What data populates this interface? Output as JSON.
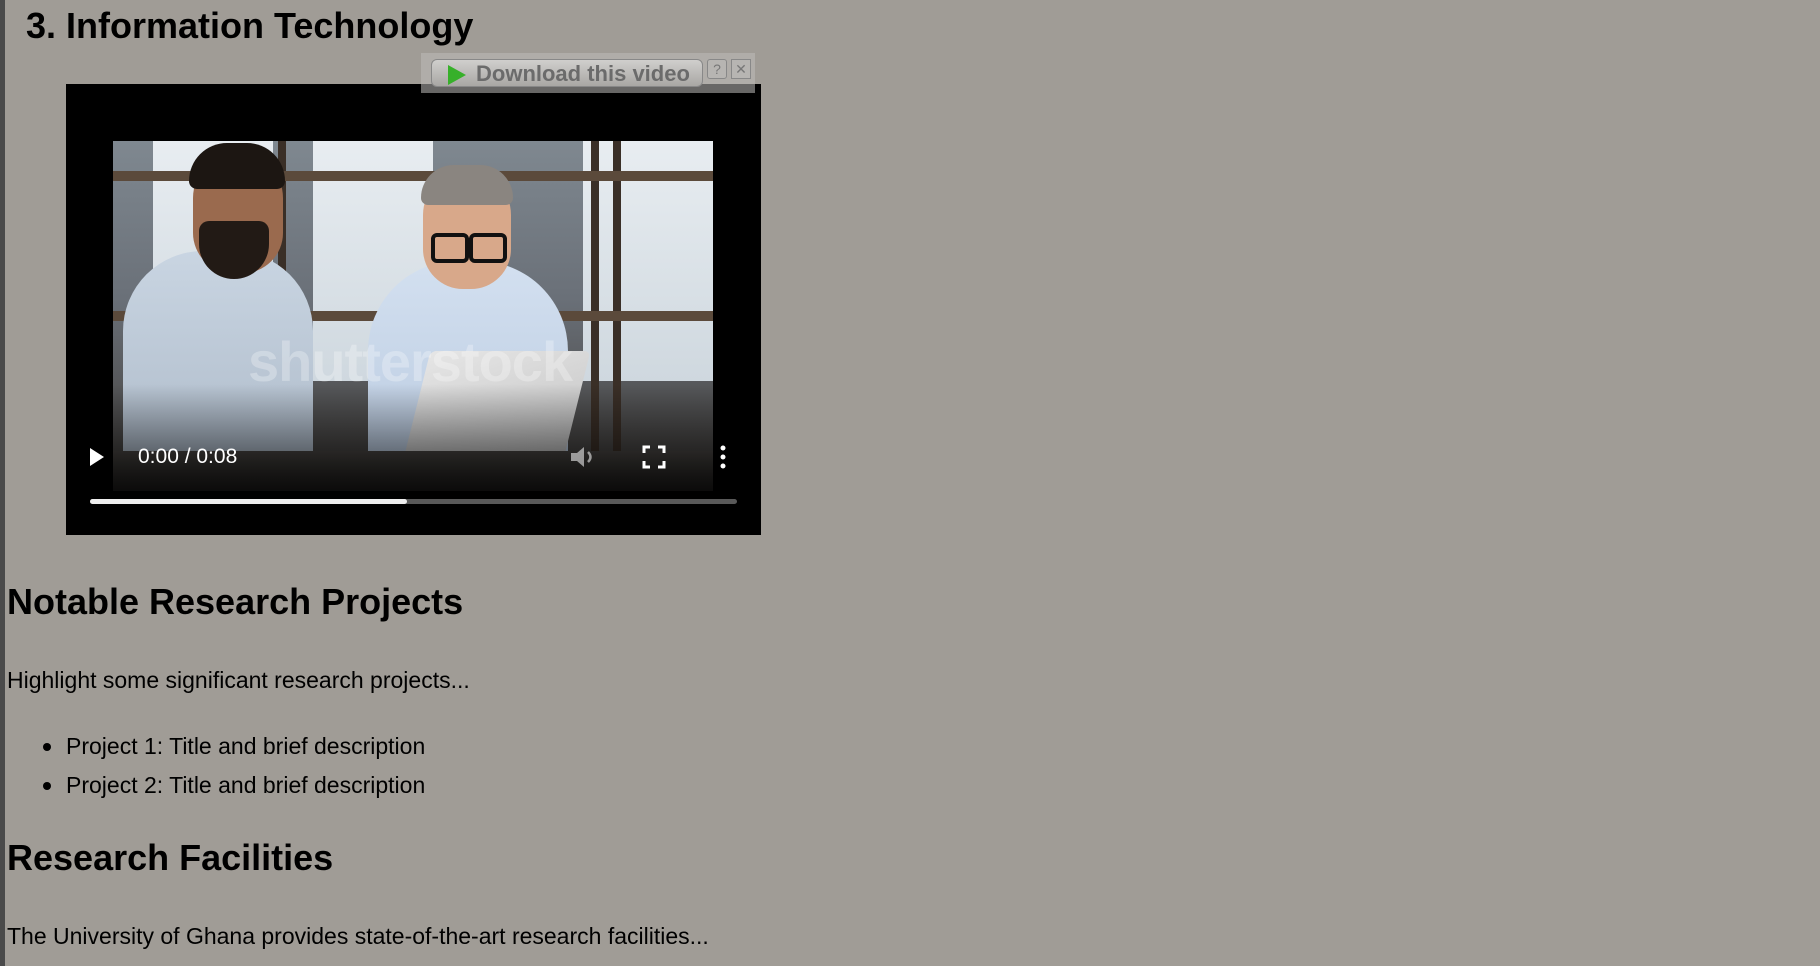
{
  "section_heading": "3. Information Technology",
  "video": {
    "time": "0:00 / 0:08",
    "watermark": "shutterstock",
    "progress_buffered": 0.49,
    "icons": {
      "play": "play-icon",
      "volume": "volume-icon",
      "fullscreen": "fullscreen-icon",
      "more": "more-options-icon"
    }
  },
  "download_overlay": {
    "button_label": "Download this video",
    "help_label": "?",
    "close_label": "✕"
  },
  "projects": {
    "heading": "Notable Research Projects",
    "intro": "Highlight some significant research projects...",
    "items": [
      "Project 1: Title and brief description",
      "Project 2: Title and brief description"
    ]
  },
  "facilities": {
    "heading": "Research Facilities",
    "text": "The University of Ghana provides state-of-the-art research facilities..."
  },
  "colors": {
    "page_background": "#a09c96",
    "download_icon": "#37b02a"
  }
}
